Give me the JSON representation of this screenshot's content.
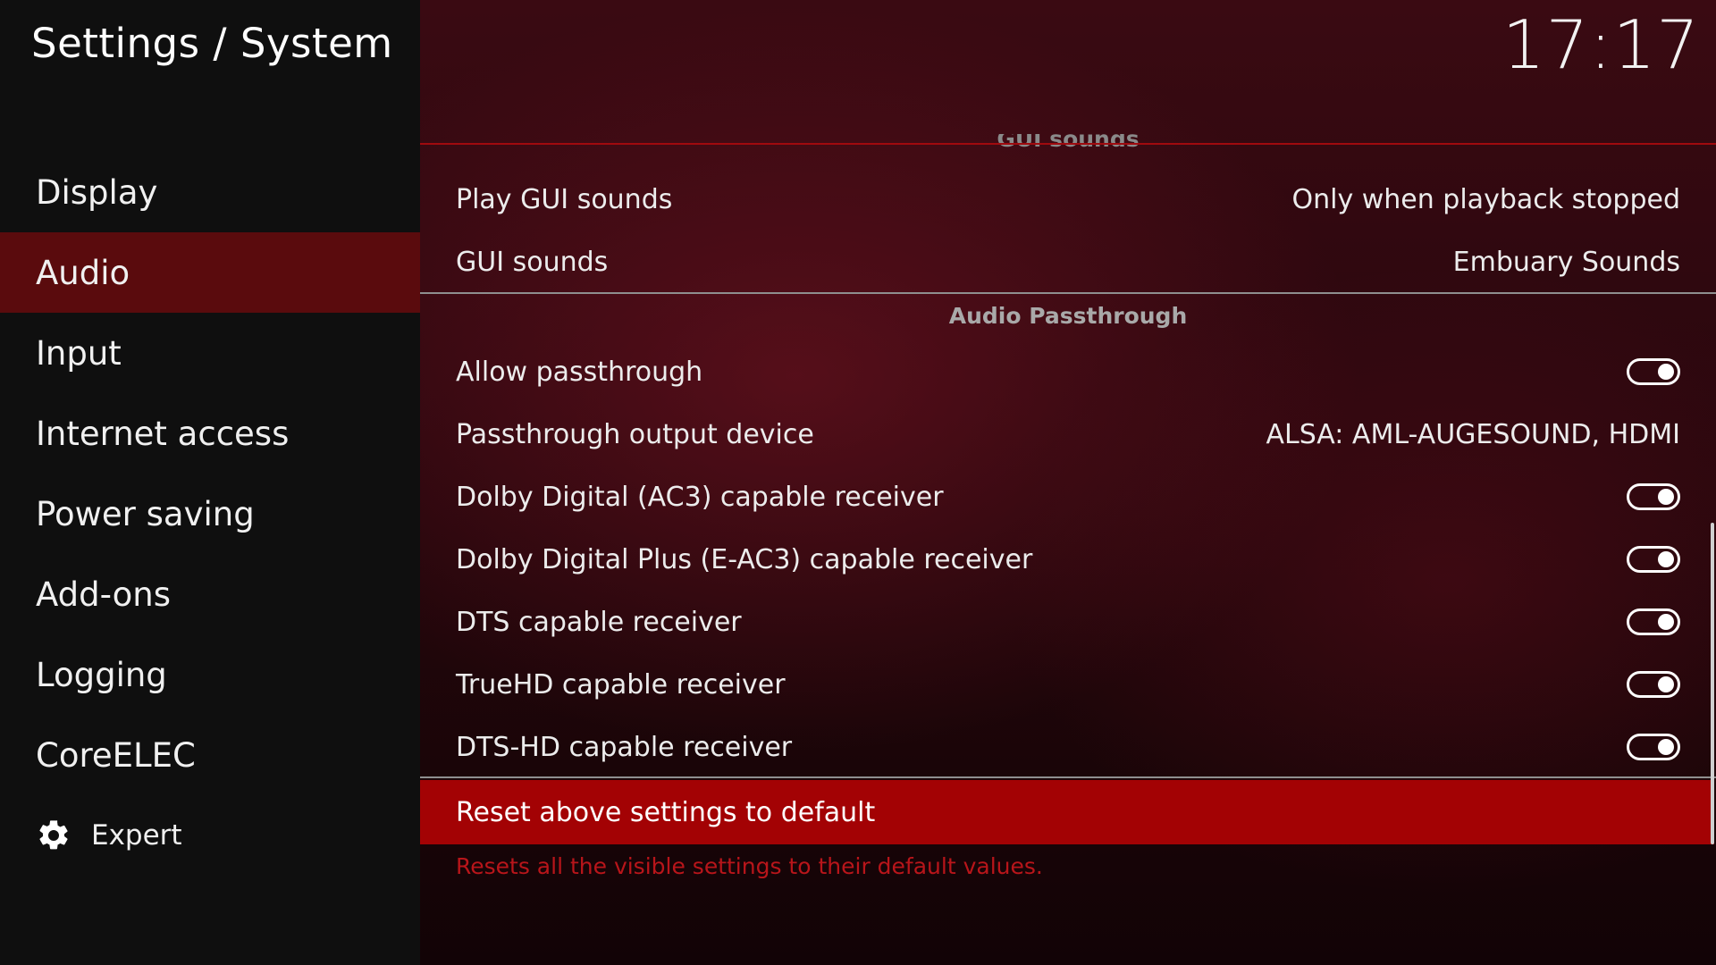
{
  "header": {
    "title": "Settings / System",
    "clock": "17:17"
  },
  "sidebar": {
    "items": [
      {
        "label": "Display"
      },
      {
        "label": "Audio",
        "selected": true
      },
      {
        "label": "Input"
      },
      {
        "label": "Internet access"
      },
      {
        "label": "Power saving"
      },
      {
        "label": "Add-ons"
      },
      {
        "label": "Logging"
      },
      {
        "label": "CoreELEC"
      }
    ],
    "level": {
      "label": "Expert",
      "icon": "gear-icon"
    }
  },
  "main": {
    "clipped_section_header": "GUI sounds",
    "gui_sounds": [
      {
        "label": "Play GUI sounds",
        "value": "Only when playback stopped"
      },
      {
        "label": "GUI sounds",
        "value": "Embuary Sounds"
      }
    ],
    "passthrough_header": "Audio Passthrough",
    "passthrough": {
      "allow": {
        "label": "Allow passthrough",
        "enabled": true
      },
      "output_device": {
        "label": "Passthrough output device",
        "value": "ALSA: AML-AUGESOUND, HDMI"
      },
      "ac3": {
        "label": "Dolby Digital (AC3) capable receiver",
        "enabled": true
      },
      "eac3": {
        "label": "Dolby Digital Plus (E-AC3) capable receiver",
        "enabled": true
      },
      "dts": {
        "label": "DTS capable receiver",
        "enabled": true
      },
      "truehd": {
        "label": "TrueHD capable receiver",
        "enabled": true
      },
      "dtshd": {
        "label": "DTS-HD capable receiver",
        "enabled": true
      }
    },
    "reset_button": "Reset above settings to default",
    "help_text": "Resets all the visible settings to their default values."
  },
  "colors": {
    "accent": "#a30204",
    "selected_nav": "#5a0b0d",
    "help_text": "#b8151a"
  }
}
